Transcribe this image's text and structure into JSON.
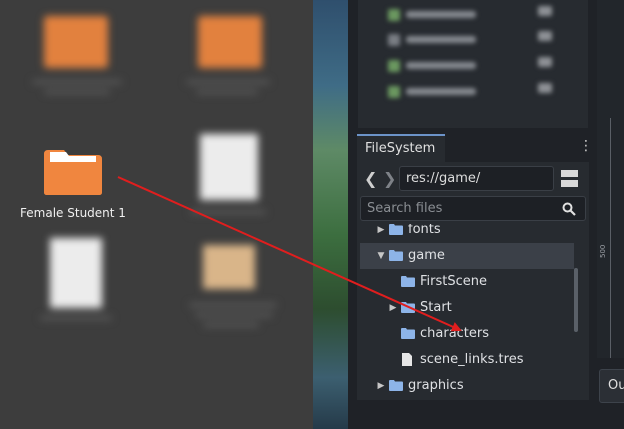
{
  "desktop_folder": {
    "label": "Female Student 1"
  },
  "filesystem": {
    "tab_label": "FileSystem",
    "menu_glyph": "⋮",
    "back_glyph": "❮",
    "forward_glyph": "❯",
    "path": "res://game/",
    "search_placeholder": "Search files",
    "tree": [
      {
        "label": "fonts",
        "type": "folder",
        "depth": 1,
        "expanded": false
      },
      {
        "label": "game",
        "type": "folder",
        "depth": 1,
        "expanded": true,
        "selected": true
      },
      {
        "label": "FirstScene",
        "type": "folder",
        "depth": 2,
        "expanded": false
      },
      {
        "label": "Start",
        "type": "folder",
        "depth": 2,
        "expanded": false
      },
      {
        "label": "characters",
        "type": "folder",
        "depth": 2,
        "expanded": false
      },
      {
        "label": "scene_links.tres",
        "type": "file",
        "depth": 2
      },
      {
        "label": "graphics",
        "type": "folder",
        "depth": 1,
        "expanded": false
      }
    ]
  },
  "ruler": {
    "label": "500"
  },
  "bottom_panel": {
    "output_label": "Output"
  },
  "colors": {
    "folder_orange": "#f0863f",
    "tree_folder_blue": "#8db4e8",
    "drag_arrow": "#e01e1e",
    "tab_accent": "#6c93c8"
  }
}
